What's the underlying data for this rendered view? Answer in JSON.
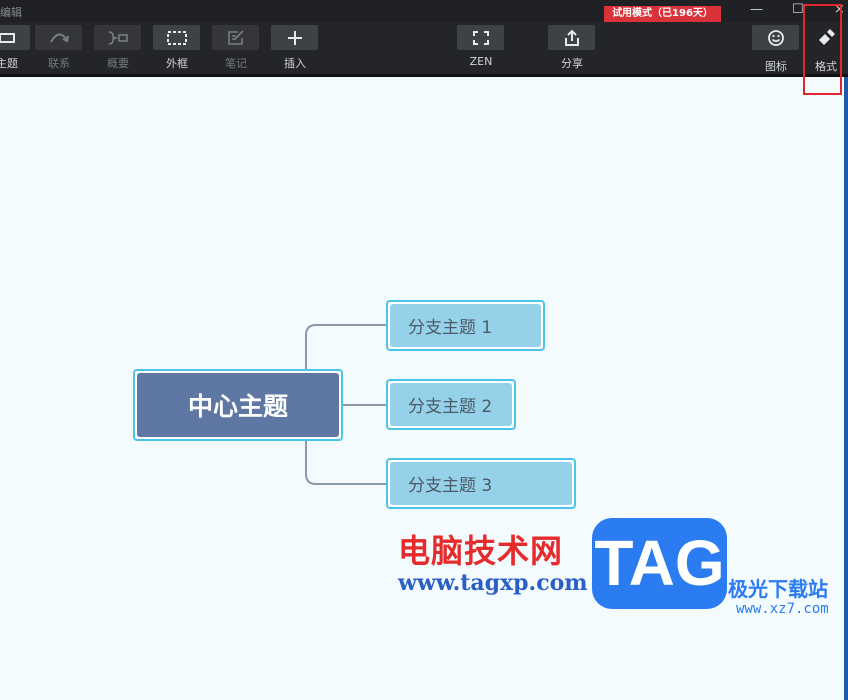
{
  "window": {
    "title": "编辑",
    "trial_badge": "试用模式（已196天）",
    "minimize": "—",
    "maximize": "☐",
    "close": "×"
  },
  "toolbar": {
    "items": [
      {
        "id": "topic",
        "label": "主题",
        "icon": "topic-icon",
        "enabled": true
      },
      {
        "id": "relation",
        "label": "联系",
        "icon": "relationship-icon",
        "enabled": false
      },
      {
        "id": "summary",
        "label": "概要",
        "icon": "summary-icon",
        "enabled": false
      },
      {
        "id": "boundary",
        "label": "外框",
        "icon": "boundary-icon",
        "enabled": true
      },
      {
        "id": "note",
        "label": "笔记",
        "icon": "note-icon",
        "enabled": false
      },
      {
        "id": "insert",
        "label": "插入",
        "icon": "plus-icon",
        "enabled": true
      },
      {
        "id": "zen",
        "label": "ZEN",
        "icon": "fullscreen-icon",
        "enabled": true
      },
      {
        "id": "share",
        "label": "分享",
        "icon": "share-icon",
        "enabled": true
      },
      {
        "id": "icon",
        "label": "图标",
        "icon": "smiley-icon",
        "enabled": true
      },
      {
        "id": "format",
        "label": "格式",
        "icon": "brush-icon",
        "enabled": true
      }
    ]
  },
  "mindmap": {
    "central": "中心主题",
    "branches": [
      "分支主题 1",
      "分支主题 2",
      "分支主题 3"
    ]
  },
  "watermark": {
    "site_cn": "电脑技术网",
    "url": "www.tagxp.com",
    "logo": "TAG",
    "site2_cn": "极光下载站",
    "site2_url": "www.xz7.com"
  },
  "colors": {
    "central_fill": "#5e77a3",
    "branch_fill": "#95d1e8",
    "topic_border": "#4cc4e8",
    "connector": "#8a9aab",
    "canvas": "#f3fbff",
    "trial_badge": "#d9323a",
    "highlight": "#e3262b"
  }
}
